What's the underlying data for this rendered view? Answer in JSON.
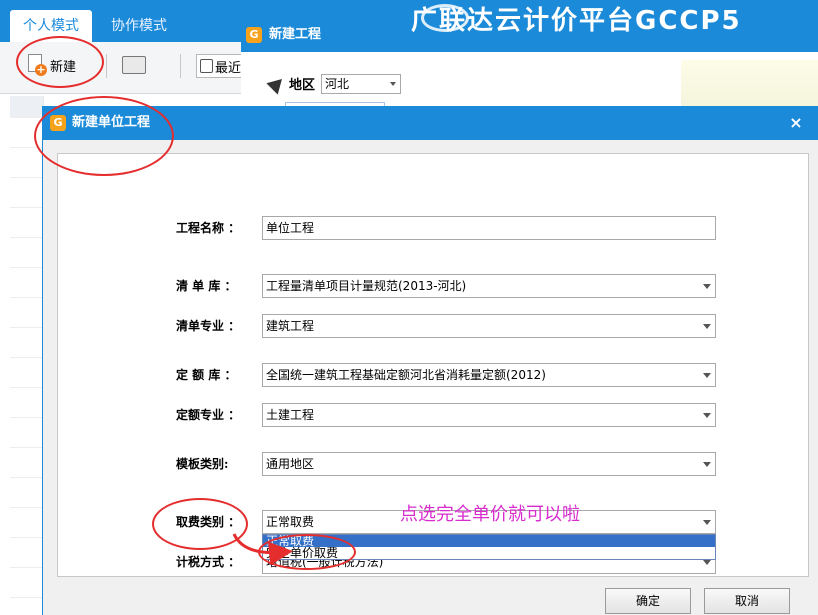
{
  "app": {
    "tabs": [
      "个人模式",
      "协作模式"
    ],
    "toolbar": {
      "new_label": "新建",
      "recent_label": "最近"
    }
  },
  "new_project_dialog": {
    "title": "新建工程",
    "brand": "广联达云计价平台GCCP5",
    "region_label": "地区",
    "region_value": "河北"
  },
  "unit_dialog": {
    "title": "新建单位工程",
    "close_glyph": "×",
    "fields": {
      "project_name": {
        "label": "工程名称 ：",
        "value": "单位工程"
      },
      "bill_library": {
        "label": "清 单 库 ：",
        "value": "工程量清单项目计量规范(2013-河北)"
      },
      "bill_specialty": {
        "label": "清单专业 ：",
        "value": "建筑工程"
      },
      "quota_library": {
        "label": "定 额 库 ：",
        "value": "全国统一建筑工程基础定额河北省消耗量定额(2012)"
      },
      "quota_specialty": {
        "label": "定额专业 ：",
        "value": "土建工程"
      },
      "template_type": {
        "label": "模板类别:",
        "value": "通用地区"
      },
      "fee_type": {
        "label": "取费类别 ：",
        "value": "正常取费",
        "options": [
          "正常取费",
          "完全单价取费"
        ],
        "highlighted_option": "正常取费"
      },
      "tax_method": {
        "label": "计税方式 ：",
        "value": "增值税(一般计税方法)"
      }
    },
    "annotation": "点选完全单价就可以啦",
    "ok_label": "确定",
    "cancel_label": "取消"
  },
  "colors": {
    "title_bar": "#1b8ad9",
    "annotation_red": "#e52d2d",
    "annotation_text": "#d82ccf",
    "dropdown_highlight": "#3470c8"
  }
}
